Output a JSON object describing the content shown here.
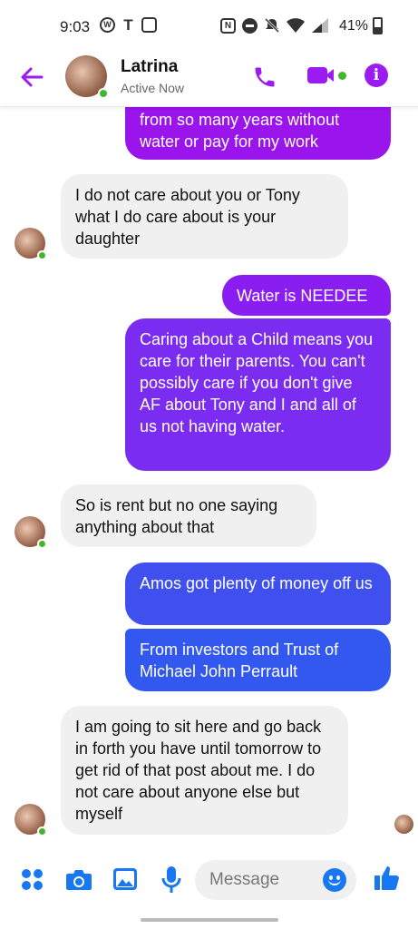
{
  "status_bar": {
    "time": "9:03",
    "battery": "41%",
    "left_icons": [
      "wordpress-icon",
      "tmobile-icon",
      "instagram-icon"
    ],
    "right_icons": [
      "nfc-icon",
      "dnd-icon",
      "mute-icon",
      "wifi-icon",
      "signal-icon",
      "battery-icon"
    ]
  },
  "header": {
    "name": "Latrina",
    "status": "Active Now",
    "accent": "#9b1bf0"
  },
  "messages": [
    {
      "side": "out",
      "text": "from so many years without water or pay for my work",
      "color": "#9a14ec"
    },
    {
      "side": "in",
      "text": "I do not care about you or Tony what I do care about is your daughter"
    },
    {
      "side": "out",
      "text": "Water is NEEDEE",
      "color": "#8a1df0"
    },
    {
      "side": "out",
      "text": "Caring about a Child means you care for their parents. You can't possibly care if you don't give AF about Tony and I and all of us not having water.",
      "color": "#7a2cf0"
    },
    {
      "side": "in",
      "text": "So is rent but no one saying anything about that"
    },
    {
      "side": "out",
      "text": "Amos got plenty of money off us",
      "color": "#3f50ef"
    },
    {
      "side": "out",
      "text": "From investors and Trust of Michael John Perrault",
      "color": "#3358ef"
    },
    {
      "side": "in",
      "text": "I am going to sit here and go back in forth you have until tomorrow to get rid of that post about me. I do not care about anyone else but myself"
    }
  ],
  "composer": {
    "placeholder": "Message",
    "icon_color": "#1877f2"
  }
}
